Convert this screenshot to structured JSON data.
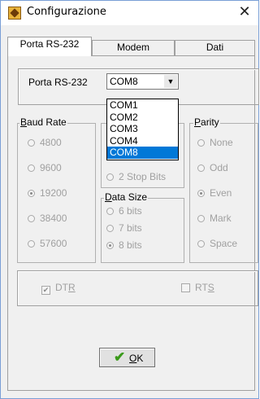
{
  "window": {
    "title": "Configurazione",
    "close_label": "✕"
  },
  "tabs": [
    {
      "label": "Porta RS-232",
      "active": true
    },
    {
      "label": "Modem",
      "active": false
    },
    {
      "label": "Dati",
      "active": false
    }
  ],
  "port": {
    "label": "Porta RS-232",
    "selected": "COM8",
    "dropdown_arrow": "▼",
    "options": [
      "COM1",
      "COM2",
      "COM3",
      "COM4",
      "COM8"
    ],
    "highlighted": "COM8"
  },
  "baud_rate": {
    "label_prefix": "B",
    "label_rest": "aud Rate",
    "options": [
      {
        "label": "4800",
        "checked": false
      },
      {
        "label": "9600",
        "checked": false
      },
      {
        "label": "19200",
        "checked": true
      },
      {
        "label": "38400",
        "checked": false
      },
      {
        "label": "57600",
        "checked": false
      }
    ]
  },
  "stop_bits": {
    "label": "2 Stop Bits",
    "checked": false
  },
  "data_size": {
    "label_prefix": "D",
    "label_rest": "ata Size",
    "options": [
      {
        "label": "6 bits",
        "checked": false
      },
      {
        "label": "7 bits",
        "checked": false
      },
      {
        "label": "8 bits",
        "checked": true
      }
    ]
  },
  "parity": {
    "label_prefix": "P",
    "label_rest": "arity",
    "options": [
      {
        "label": "None",
        "checked": false
      },
      {
        "label": "Odd",
        "checked": false
      },
      {
        "label": "Even",
        "checked": true
      },
      {
        "label": "Mark",
        "checked": false
      },
      {
        "label": "Space",
        "checked": false
      }
    ]
  },
  "flow": {
    "dtr": {
      "label_prefix": "DT",
      "label_underlined": "R",
      "checked": true
    },
    "rts": {
      "label_prefix": "RT",
      "label_underlined": "S",
      "checked": false
    }
  },
  "ok_button": {
    "label_underlined": "O",
    "label_rest": "K",
    "icon": "checkmark-icon"
  }
}
